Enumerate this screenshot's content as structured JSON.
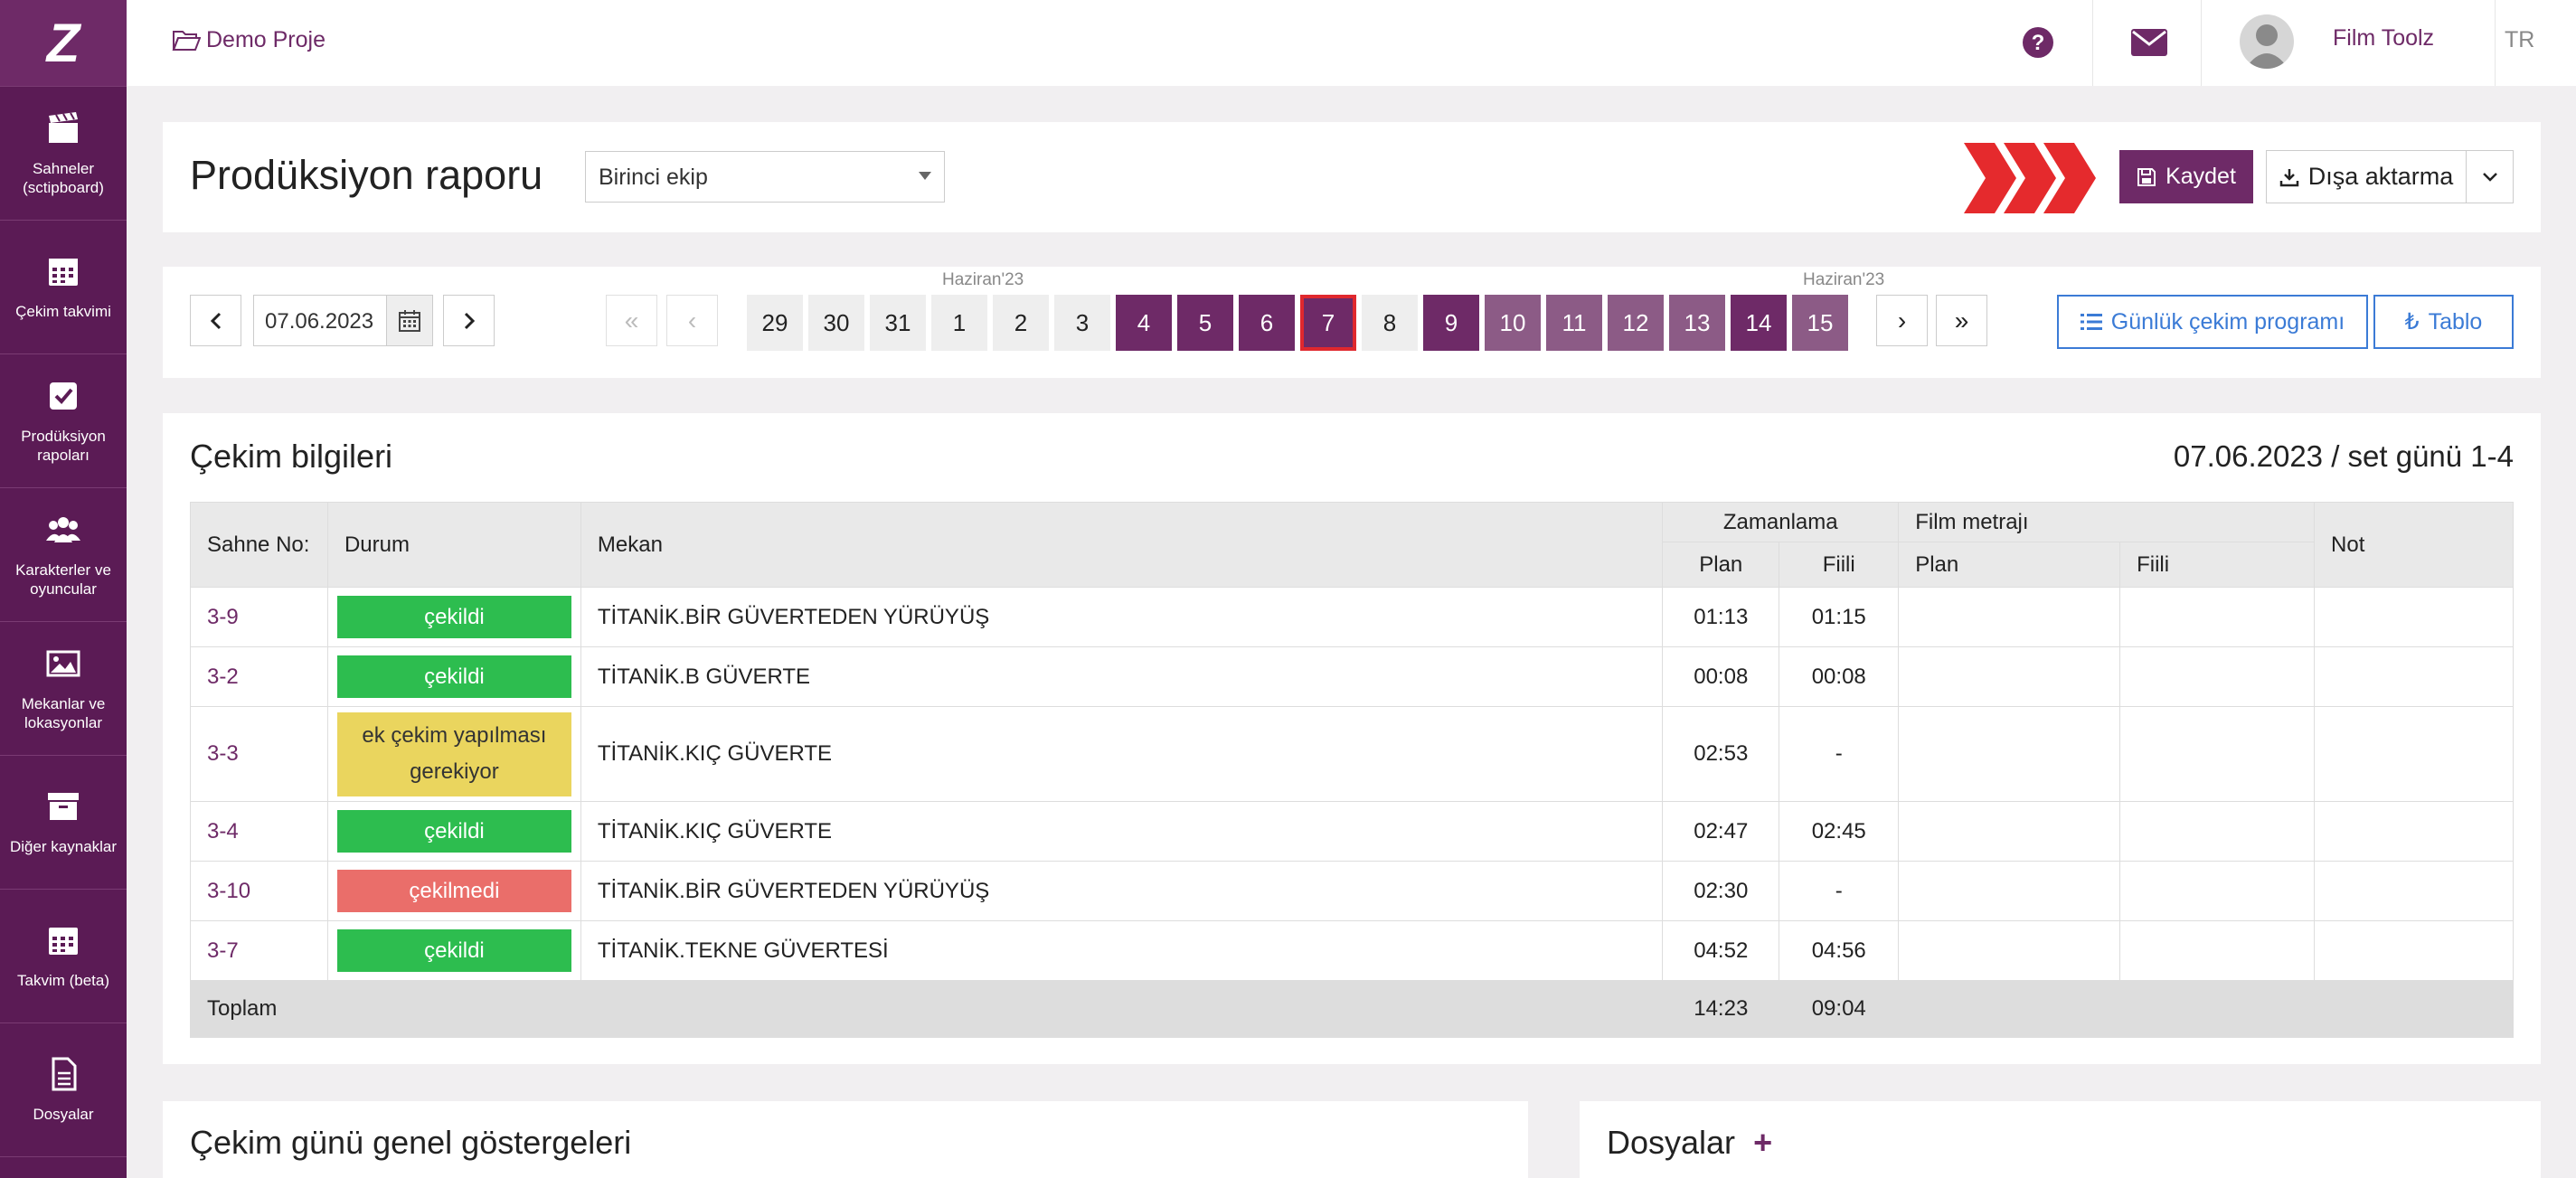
{
  "sidebar": {
    "logo": "Z",
    "items": [
      {
        "label": "Sahneler (sctipboard)",
        "icon": "clapperboard-icon"
      },
      {
        "label": "Çekim takvimi",
        "icon": "calendar-icon"
      },
      {
        "label": "Prodüksiyon rapoları",
        "icon": "checkbox-icon"
      },
      {
        "label": "Karakterler ve oyuncular",
        "icon": "users-icon"
      },
      {
        "label": "Mekanlar ve lokasyonlar",
        "icon": "image-icon"
      },
      {
        "label": "Diğer kaynaklar",
        "icon": "archive-icon"
      },
      {
        "label": "Takvim (beta)",
        "icon": "calendar-grid-icon"
      },
      {
        "label": "Dosyalar",
        "icon": "file-icon"
      }
    ]
  },
  "topbar": {
    "breadcrumb": "Demo Proje",
    "user_name": "Film Toolz",
    "language": "TR"
  },
  "header": {
    "title": "Prodüksiyon raporu",
    "crew_select": "Birinci ekip",
    "save_label": "Kaydet",
    "export_label": "Dışa aktarma"
  },
  "datebar": {
    "date_value": "07.06.2023",
    "month_left": "Haziran'23",
    "month_right": "Haziran'23",
    "days": [
      "29",
      "30",
      "31",
      "1",
      "2",
      "3",
      "4",
      "5",
      "6",
      "7",
      "8",
      "9",
      "10",
      "11",
      "12",
      "13",
      "14",
      "15"
    ],
    "first_label": "«",
    "prev_label": "‹",
    "next_label": "›",
    "last_label": "»",
    "daily_program_label": "Günlük çekim programı",
    "table_label": "Tablo"
  },
  "shooting": {
    "title": "Çekim bilgileri",
    "date_info": "07.06.2023 / set günü 1-4",
    "headers": {
      "scene_no": "Sahne No:",
      "status": "Durum",
      "location": "Mekan",
      "timing": "Zamanlama",
      "film_length": "Film metrajı",
      "note": "Not",
      "plan": "Plan",
      "actual": "Fiili"
    },
    "rows": [
      {
        "scene": "3-9",
        "status": "çekildi",
        "location": "TİTANİK.BİR GÜVERTEDEN YÜRÜYÜŞ",
        "plan": "01:13",
        "actual": "01:15"
      },
      {
        "scene": "3-2",
        "status": "çekildi",
        "location": "TİTANİK.B GÜVERTE",
        "plan": "00:08",
        "actual": "00:08"
      },
      {
        "scene": "3-3",
        "status": "ek çekim yapılması gerekiyor",
        "location": "TİTANİK.KIÇ GÜVERTE",
        "plan": "02:53",
        "actual": "-"
      },
      {
        "scene": "3-4",
        "status": "çekildi",
        "location": "TİTANİK.KIÇ GÜVERTE",
        "plan": "02:47",
        "actual": "02:45"
      },
      {
        "scene": "3-10",
        "status": "çekilmedi",
        "location": "TİTANİK.BİR GÜVERTEDEN YÜRÜYÜŞ",
        "plan": "02:30",
        "actual": "-"
      },
      {
        "scene": "3-7",
        "status": "çekildi",
        "location": "TİTANİK.TEKNE GÜVERTESİ",
        "plan": "04:52",
        "actual": "04:56"
      }
    ],
    "total_label": "Toplam",
    "total_plan": "14:23",
    "total_actual": "09:04"
  },
  "indicators_title": "Çekim günü genel göstergeleri",
  "files_title": "Dosyalar",
  "files_add": "+",
  "colors": {
    "brand": "#6e2a67",
    "sidebar": "#5b1b55",
    "ok": "#2dbd4f",
    "not_shot": "#ea6e6a",
    "reshoot": "#ead55e",
    "selected_border": "#e0282e",
    "link_blue": "#3b7bd6"
  }
}
